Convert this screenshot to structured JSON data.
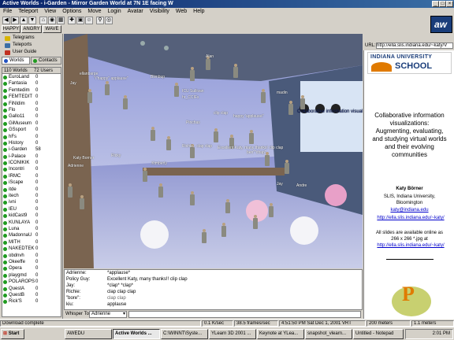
{
  "window": {
    "title": "Active Worlds - i-Garden - Mirror Garden World at 7N 1E facing W"
  },
  "menu": [
    "File",
    "Teleport",
    "View",
    "Options",
    "Move",
    "Login",
    "Avatar",
    "Visibility",
    "Web",
    "Help"
  ],
  "gestures": [
    "HAPPY",
    "ANGRY",
    "WAVE"
  ],
  "nav": {
    "telegrams": "Telegrams",
    "teleports": "Teleports",
    "user_guide": "User Guide",
    "worlds_tab": "Worlds",
    "contacts_tab": "Contacts"
  },
  "worlds": {
    "header_worlds": "110 Worlds",
    "header_users": "72 Users",
    "items": [
      {
        "name": "EuroLand",
        "count": "0"
      },
      {
        "name": "Fantasia",
        "count": "0"
      },
      {
        "name": "Femtedim",
        "count": "0"
      },
      {
        "name": "FEMTEDIT",
        "count": "0"
      },
      {
        "name": "FiNIdim",
        "count": "0"
      },
      {
        "name": "Flo",
        "count": "0"
      },
      {
        "name": "Gallo11",
        "count": "0"
      },
      {
        "name": "GiMuseum",
        "count": "0"
      },
      {
        "name": "GSsport",
        "count": "0"
      },
      {
        "name": "hFs",
        "count": "0"
      },
      {
        "name": "History",
        "count": "0"
      },
      {
        "name": "i-Garden",
        "count": "58"
      },
      {
        "name": "i-Palace",
        "count": "0"
      },
      {
        "name": "ICONIKIK",
        "count": "0"
      },
      {
        "name": "Incontri",
        "count": "0"
      },
      {
        "name": "IRMC",
        "count": "0"
      },
      {
        "name": "iScape",
        "count": "0"
      },
      {
        "name": "itde",
        "count": "0"
      },
      {
        "name": "itech",
        "count": "0"
      },
      {
        "name": "ivni",
        "count": "0"
      },
      {
        "name": "IEU",
        "count": "0"
      },
      {
        "name": "kidCast9",
        "count": "0"
      },
      {
        "name": "KUNLAYA",
        "count": "0"
      },
      {
        "name": "Luna",
        "count": "0"
      },
      {
        "name": "MadonnaU",
        "count": "0"
      },
      {
        "name": "MITH",
        "count": "0"
      },
      {
        "name": "NAKEDTEK",
        "count": "0"
      },
      {
        "name": "obdnvh",
        "count": "0"
      },
      {
        "name": "Okeeffe",
        "count": "0"
      },
      {
        "name": "Opera",
        "count": "0"
      },
      {
        "name": "playgmd",
        "count": "0"
      },
      {
        "name": "POLAROPS",
        "count": "0"
      },
      {
        "name": "QuestA",
        "count": "0"
      },
      {
        "name": "QuestB",
        "count": "0"
      },
      {
        "name": "Rick'S",
        "count": "0"
      }
    ]
  },
  "viewport": {
    "labels": [
      "Jay",
      "ellanbarge",
      "\"i\"happy\" applause\"",
      "Blimbup",
      "ICU Sullivan",
      "hr_CCIFs",
      "Pinchas",
      "clip clap",
      "happy 'applause!'",
      "Richie - clap clap",
      "Excellent Katy, many thanks! clip clap",
      "ben\"\"chap\"",
      "Adrienne",
      "Katy Borner",
      "Alan",
      "Ricky",
      "Jay",
      "madin",
      ".Kimberly",
      "Andre"
    ],
    "billboard": "Collaborative information visualizations"
  },
  "chat": {
    "lines": [
      {
        "name": "Adrienne:",
        "msg": "*applause*",
        "gray": false
      },
      {
        "name": "Policy Guy:",
        "msg": "Excellent Katy, many thanks!! clip clap",
        "gray": false
      },
      {
        "name": "Jay:",
        "msg": "*clap* *clap*",
        "gray": false
      },
      {
        "name": "Richie:",
        "msg": "clap clap clap",
        "gray": false
      },
      {
        "name": "\"bore\":",
        "msg": "clap clap",
        "gray": true
      },
      {
        "name": "kiu:",
        "msg": "applause",
        "gray": false
      }
    ],
    "whisper_label": "Whisper To:",
    "whisper_value": "Adrienne"
  },
  "browser": {
    "url_label": "URL:",
    "url": "http://ella.slis.indiana.edu/~katy/V",
    "logo_text": "INDIANA UNIVERSITY",
    "logo_sub": "SCHOOL",
    "title": "Collaborative information visualizations: Augmenting, evaluating, and studying virtual worlds and their evolving communities",
    "author": "Katy Börner",
    "affil": "SLIS, Indiana University, Bloomington",
    "email": "katy@indiana.edu",
    "link1": "http://ella.slis.indiana.edu/~katy/",
    "slides": "All slides are available online as 266 x 266 *.jpg at",
    "link2": "http://ella.slis.indiana.edu/~katy/"
  },
  "status": [
    "Download complete",
    "0.1 K/sec",
    "38.5 frames/sec",
    "4:51:50 PM Sat Dec 1, 2001 VRT",
    "200 meters",
    "1.1 meters"
  ],
  "taskbar": {
    "start": "Start",
    "items": [
      "AWEDU",
      "Active Worlds ...",
      "C:\\WINNT\\Syste...",
      "YLearn 3D 2001 ...",
      "Keynote at YLea...",
      "snapshot_vlearn...",
      "Untitled - Notepad"
    ],
    "clock": "2:01 PM"
  },
  "colors": {
    "titlebar": "#0a246a",
    "world_dot": "#1f9a1f",
    "accent_orange": "#e07a00"
  }
}
